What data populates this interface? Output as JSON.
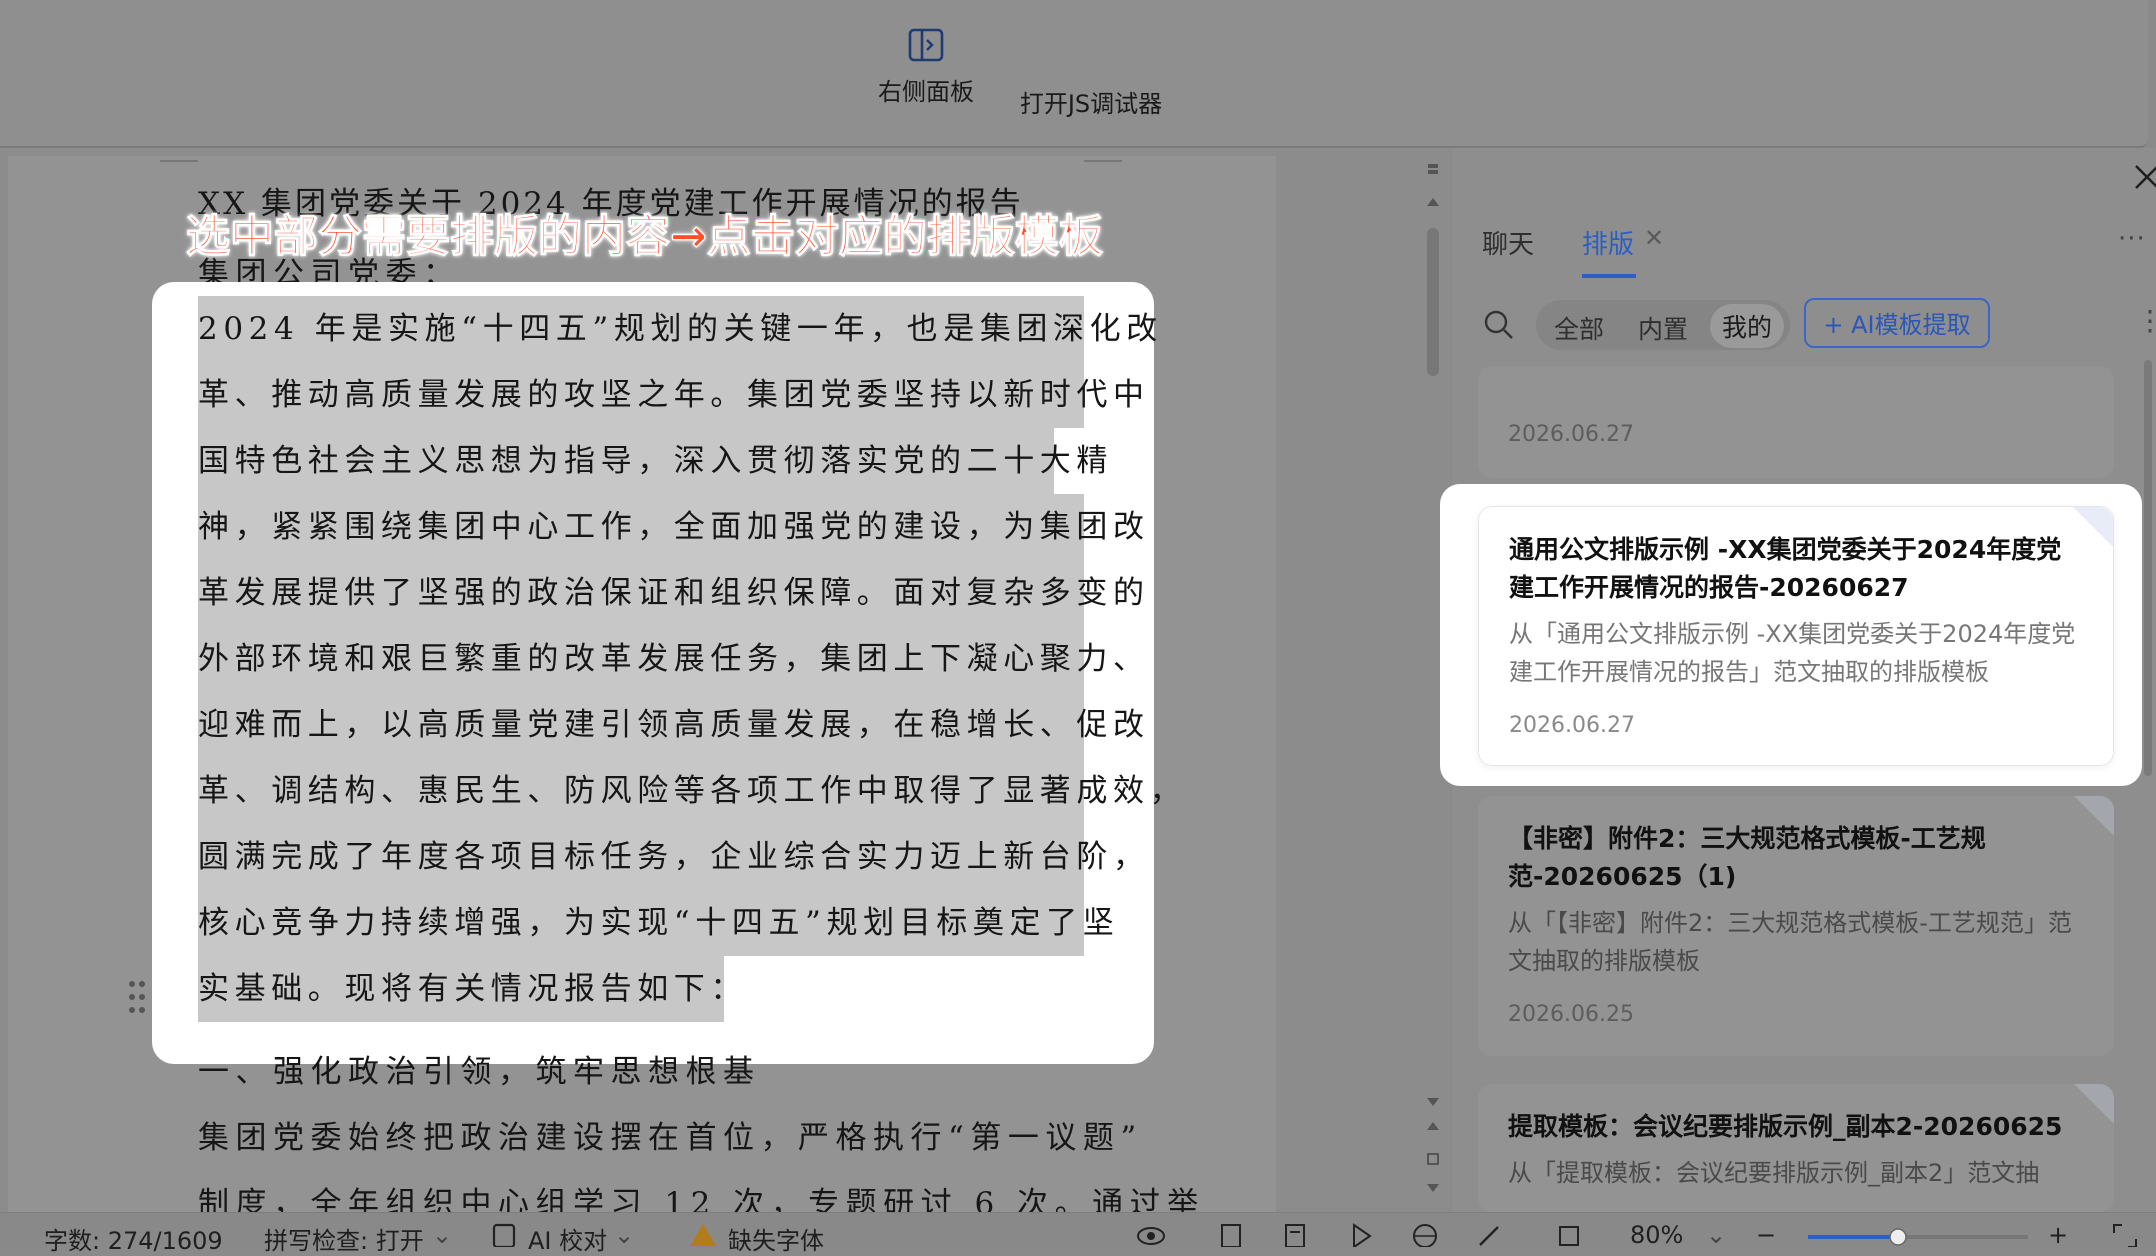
{
  "toolbar": {
    "right_panel_label": "右侧面板",
    "js_debugger_label": "打开JS调试器"
  },
  "document": {
    "title_line": "XX 集团党委关于 2024 年度党建工作开展情况的报告",
    "annotation": "选中部分需要排版的内容→点击对应的排版模板",
    "salutation": "集团公司党委：",
    "selected_lines": [
      "2024 年是实施“十四五”规划的关键一年，也是集团深化改",
      "革、推动高质量发展的攻坚之年。集团党委坚持以新时代中",
      "国特色社会主义思想为指导，深入贯彻落实党的二十大精",
      "神，紧紧围绕集团中心工作，全面加强党的建设，为集团改",
      "革发展提供了坚强的政治保证和组织保障。面对复杂多变的",
      "外部环境和艰巨繁重的改革发展任务，集团上下凝心聚力、",
      "迎难而上，以高质量党建引领高质量发展，在稳增长、促改",
      "革、调结构、惠民生、防风险等各项工作中取得了显著成效，",
      "圆满完成了年度各项目标任务，企业综合实力迈上新台阶，",
      "核心竞争力持续增强，为实现“十四五”规划目标奠定了坚",
      "实基础。现将有关情况报告如下："
    ],
    "heading_1": "一、强化政治引领，筑牢思想根基",
    "after_lines": [
      "集团党委始终把政治建设摆在首位，严格执行“第一议题”",
      "制度，全年组织中心组学习 12 次，专题研讨 6 次。通过举"
    ]
  },
  "panel": {
    "tabs": [
      {
        "label": "聊天"
      },
      {
        "label": "排版"
      }
    ],
    "filters": [
      "全部",
      "内置",
      "我的"
    ],
    "ai_extract_label": "+ AI模板提取",
    "cards": [
      {
        "title": "",
        "desc": "",
        "date": "2026.06.27"
      },
      {
        "title": "通用公文排版示例 -XX集团党委关于2024年度党建工作开展情况的报告-20260627",
        "desc": "从「通用公文排版示例 -XX集团党委关于2024年度党建工作开展情况的报告」范文抽取的排版模板",
        "date": "2026.06.27"
      },
      {
        "title": "【非密】附件2：三大规范格式模板-工艺规范-20260625（1)",
        "desc": "从「【非密】附件2：三大规范格式模板-工艺规范」范文抽取的排版模板",
        "date": "2026.06.25"
      },
      {
        "title": "提取模板：会议纪要排版示例_副本2-20260625",
        "desc": "从「提取模板：会议纪要排版示例_副本2」范文抽",
        "date": ""
      }
    ]
  },
  "status": {
    "word_count": "字数: 274/1609",
    "spellcheck": "拼写检查: 打开",
    "ai_proof": "AI 校对",
    "missing_font": "缺失字体",
    "zoom": "80%"
  },
  "colors": {
    "accent": "#2b5fc6",
    "annotation": "#ff4f2e",
    "selection": "#c7c7c7"
  }
}
